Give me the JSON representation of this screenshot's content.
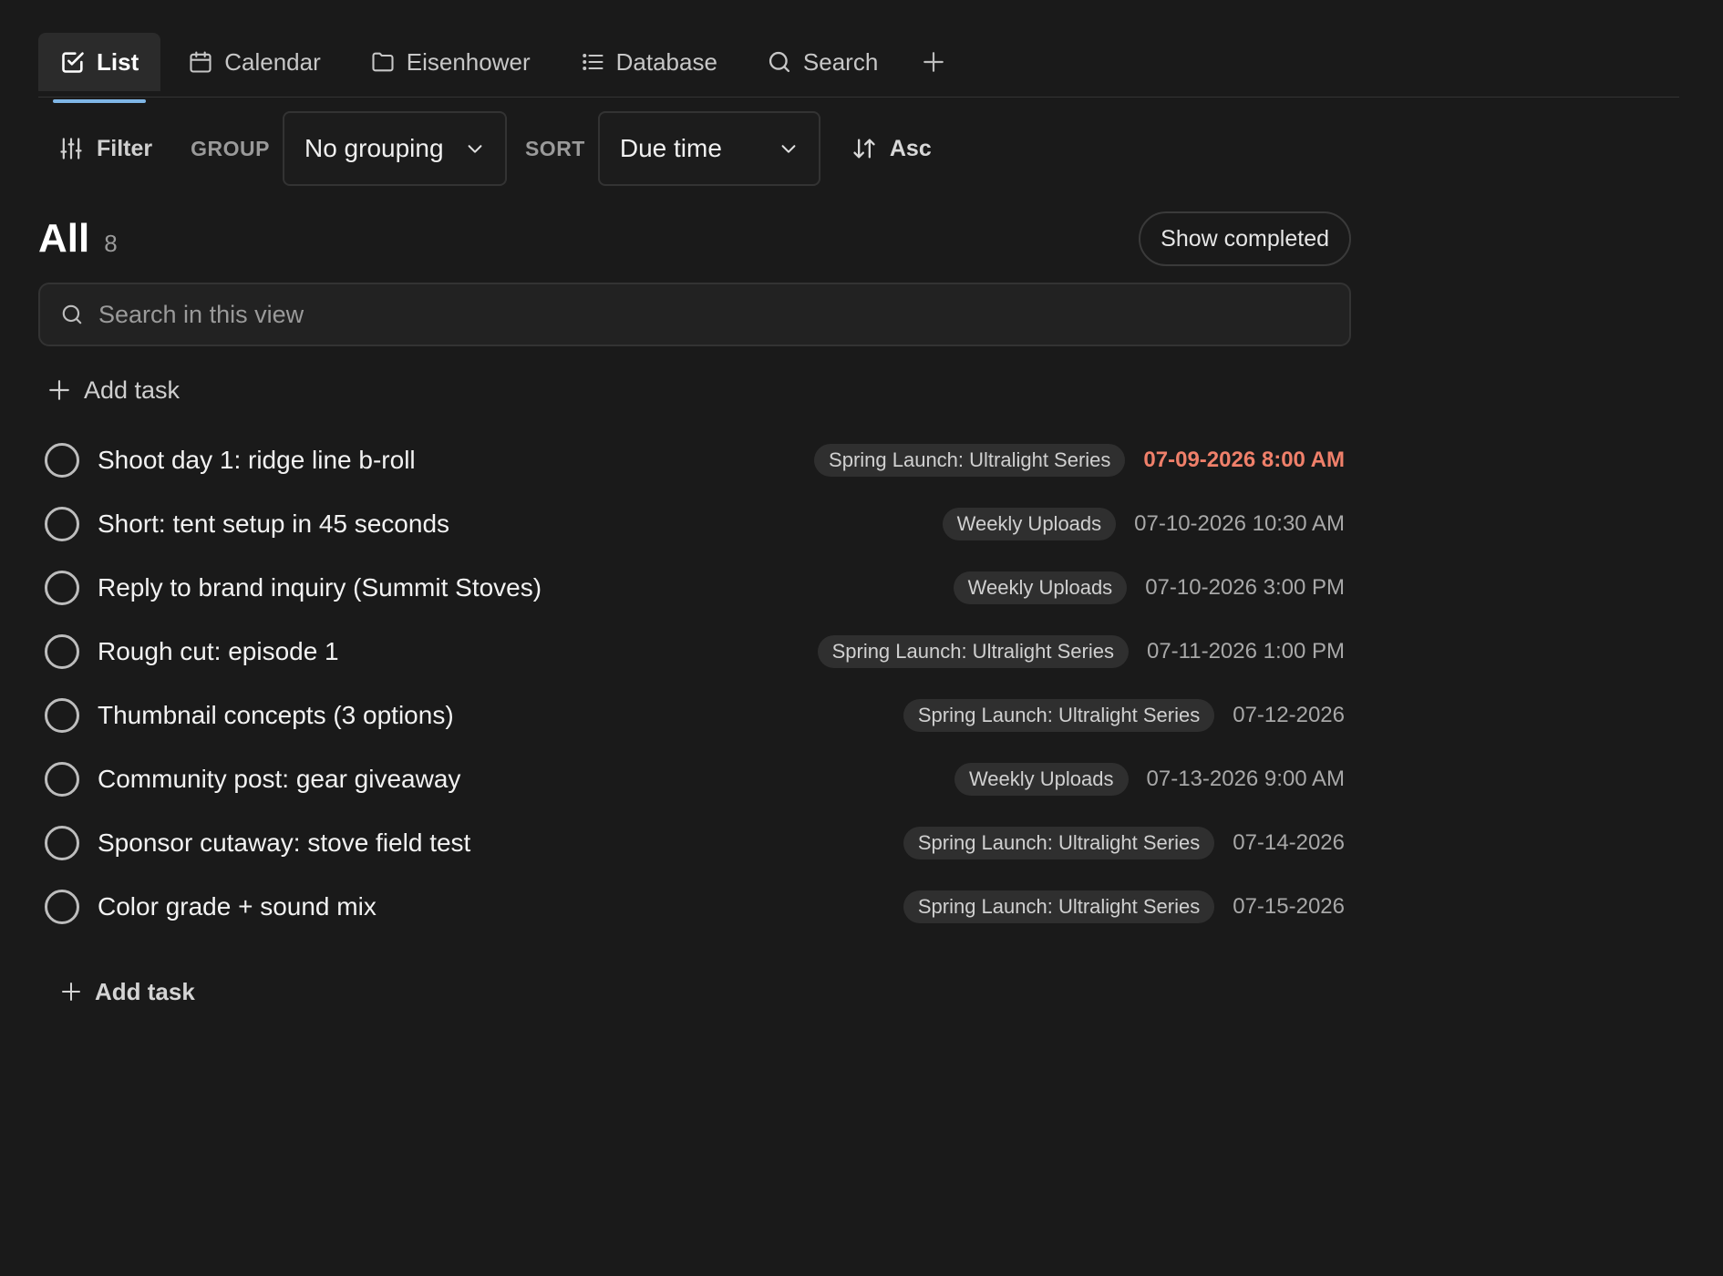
{
  "tabs": [
    {
      "label": "List",
      "icon": "checkbox-icon",
      "active": true
    },
    {
      "label": "Calendar",
      "icon": "calendar-icon",
      "active": false
    },
    {
      "label": "Eisenhower",
      "icon": "folder-icon",
      "active": false
    },
    {
      "label": "Database",
      "icon": "list-icon",
      "active": false
    },
    {
      "label": "Search",
      "icon": "search-icon",
      "active": false
    }
  ],
  "toolbar": {
    "filter_label": "Filter",
    "group_label": "GROUP",
    "group_value": "No grouping",
    "sort_label": "SORT",
    "sort_value": "Due time",
    "order_label": "Asc"
  },
  "view": {
    "title": "All",
    "count": "8",
    "show_completed_label": "Show completed"
  },
  "search": {
    "placeholder": "Search in this view"
  },
  "add_task_label": "Add task",
  "tasks": [
    {
      "title": "Shoot day 1: ridge line b-roll",
      "tag": "Spring Launch: Ultralight Series",
      "due": "07-09-2026 8:00 AM",
      "overdue": true
    },
    {
      "title": "Short: tent setup in 45 seconds",
      "tag": "Weekly Uploads",
      "due": "07-10-2026 10:30 AM",
      "overdue": false
    },
    {
      "title": "Reply to brand inquiry (Summit Stoves)",
      "tag": "Weekly Uploads",
      "due": "07-10-2026 3:00 PM",
      "overdue": false
    },
    {
      "title": "Rough cut: episode 1",
      "tag": "Spring Launch: Ultralight Series",
      "due": "07-11-2026 1:00 PM",
      "overdue": false
    },
    {
      "title": "Thumbnail concepts (3 options)",
      "tag": "Spring Launch: Ultralight Series",
      "due": "07-12-2026",
      "overdue": false
    },
    {
      "title": "Community post: gear giveaway",
      "tag": "Weekly Uploads",
      "due": "07-13-2026 9:00 AM",
      "overdue": false
    },
    {
      "title": "Sponsor cutaway: stove field test",
      "tag": "Spring Launch: Ultralight Series",
      "due": "07-14-2026",
      "overdue": false
    },
    {
      "title": "Color grade + sound mix",
      "tag": "Spring Launch: Ultralight Series",
      "due": "07-15-2026",
      "overdue": false
    }
  ],
  "colors": {
    "background": "#1a1a1a",
    "accent_underline": "#7fb6e6",
    "overdue": "#f0806a"
  }
}
